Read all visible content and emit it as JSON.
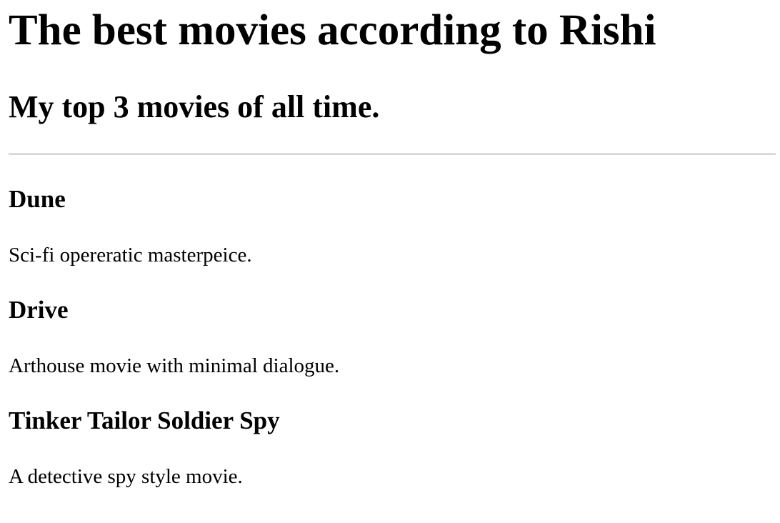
{
  "page": {
    "title": "The best movies according to Rishi",
    "subtitle": "My top 3 movies of all time."
  },
  "movies": [
    {
      "title": "Dune",
      "description": "Sci-fi opereratic masterpeice."
    },
    {
      "title": "Drive",
      "description": "Arthouse movie with minimal dialogue."
    },
    {
      "title": "Tinker Tailor Soldier Spy",
      "description": "A detective spy style movie."
    }
  ]
}
